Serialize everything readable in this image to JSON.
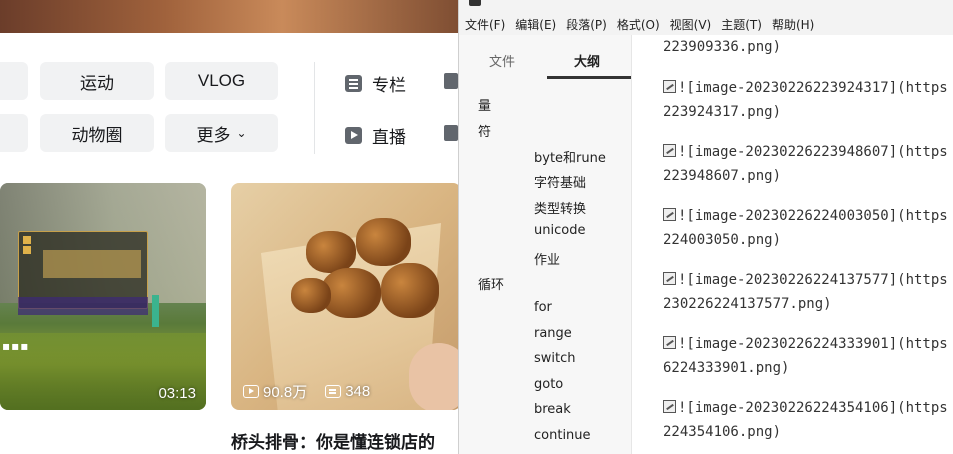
{
  "bilibili": {
    "chips": {
      "sports": "运动",
      "vlog": "VLOG",
      "animals": "动物圈",
      "more": "更多",
      "more_chevron": "⌄"
    },
    "nav": {
      "column": "专栏",
      "live": "直播"
    },
    "videos": [
      {
        "duration": "03:13"
      },
      {
        "views": "90.8万",
        "danmaku": "348",
        "title": "桥头排骨：你是懂连锁店的"
      }
    ],
    "icons": [
      "doc-icon",
      "camera-icon",
      "play-count-icon",
      "danmaku-icon"
    ]
  },
  "typora": {
    "menu": [
      "文件(F)",
      "编辑(E)",
      "段落(P)",
      "格式(O)",
      "视图(V)",
      "主题(T)",
      "帮助(H)"
    ],
    "sidebar": {
      "tabs": [
        "文件",
        "大纲"
      ],
      "active_tab": "大纲",
      "outline": [
        {
          "label": "量",
          "level": 1
        },
        {
          "label": "符",
          "level": 1
        },
        {
          "label": "byte和rune",
          "level": 2
        },
        {
          "label": "字符基础",
          "level": 2
        },
        {
          "label": "类型转换",
          "level": 2
        },
        {
          "label": "unicode",
          "level": 2
        },
        {
          "label": "作业",
          "level": 2
        },
        {
          "label": "循环",
          "level": 1
        },
        {
          "label": "for",
          "level": 2
        },
        {
          "label": "range",
          "level": 2
        },
        {
          "label": "switch",
          "level": 2
        },
        {
          "label": "goto",
          "level": 2
        },
        {
          "label": "break",
          "level": 2
        },
        {
          "label": "continue",
          "level": 2
        }
      ]
    },
    "editor_lines": [
      {
        "text": "223909336.png)",
        "has_icon": false
      },
      {
        "text": "![image-20230226223924317](https",
        "has_icon": true
      },
      {
        "text": "223924317.png)",
        "has_icon": false
      },
      {
        "text": "![image-20230226223948607](https",
        "has_icon": true
      },
      {
        "text": "223948607.png)",
        "has_icon": false
      },
      {
        "text": "![image-20230226224003050](https",
        "has_icon": true
      },
      {
        "text": "224003050.png)",
        "has_icon": false
      },
      {
        "text": "![image-20230226224137577](https",
        "has_icon": true
      },
      {
        "text": "230226224137577.png)",
        "has_icon": false
      },
      {
        "text": "![image-20230226224333901](https",
        "has_icon": true
      },
      {
        "text": "6224333901.png)",
        "has_icon": false
      },
      {
        "text": "![image-20230226224354106](https",
        "has_icon": true
      },
      {
        "text": "224354106.png)",
        "has_icon": false
      }
    ]
  }
}
